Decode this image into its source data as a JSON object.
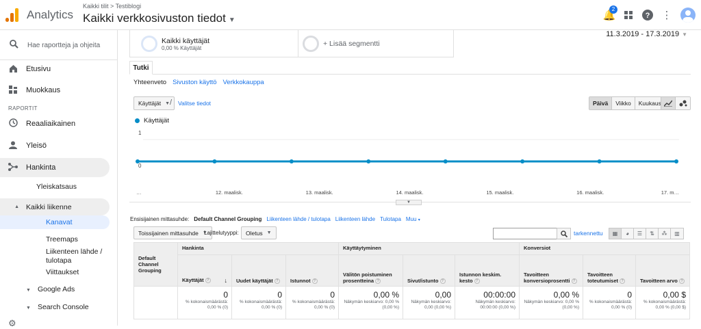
{
  "header": {
    "app_title": "Analytics",
    "breadcrumb": "Kaikki tilit > Testiblogi",
    "view_title": "Kaikki verkkosivuston tiedot",
    "notification_count": "2"
  },
  "sidebar": {
    "search_placeholder": "Hae raportteja ja ohjeita",
    "home": "Etusivu",
    "customize": "Muokkaus",
    "section_reports": "RAPORTIT",
    "realtime": "Reaaliaikainen",
    "audience": "Yleisö",
    "acquisition": "Hankinta",
    "overview": "Yleiskatsaus",
    "all_traffic": "Kaikki liikenne",
    "channels": "Kanavat",
    "treemaps": "Treemaps",
    "source_medium": "Liikenteen lähde / tulotapa",
    "referrals": "Viittaukset",
    "google_ads": "Google Ads",
    "search_console": "Search Console"
  },
  "segments": {
    "seg1_title": "Kaikki käyttäjät",
    "seg1_sub": "0,00 % Käyttäjät",
    "seg2_title": "+ Lisää segmentti"
  },
  "date_range": "11.3.2019 - 17.3.2019",
  "tab_label": "Tutki",
  "subtabs": {
    "summary": "Yhteenveto",
    "site_usage": "Sivuston käyttö",
    "ecommerce": "Verkkokauppa"
  },
  "controls": {
    "metric": "Käyttäjät",
    "select_metric": "Valitse tiedot",
    "day": "Päivä",
    "week": "Viikko",
    "month": "Kuukausi"
  },
  "chart_data": {
    "type": "line",
    "series": [
      {
        "name": "Käyttäjät",
        "values": [
          0,
          0,
          0,
          0,
          0,
          0,
          0,
          0
        ]
      }
    ],
    "x": [
      "…",
      "12. maalisk.",
      "13. maalisk.",
      "14. maalisk.",
      "15. maalisk.",
      "16. maalisk.",
      "17. m…"
    ],
    "ylim": [
      0,
      1
    ],
    "yticks": [
      "1",
      "0"
    ],
    "color": "#058dc7"
  },
  "dimensions": {
    "label": "Ensisijainen mittasuhde:",
    "active": "Default Channel Grouping",
    "links": [
      "Liikenteen lähde / tulotapa",
      "Liikenteen lähde",
      "Tulotapa",
      "Muu"
    ]
  },
  "table_controls": {
    "secondary": "Toissijainen mittasuhde",
    "sort_type_label": "Lajittelutyyppi:",
    "sort_type": "Oletus",
    "advanced": "tarkennettu"
  },
  "table": {
    "dim_header": "Default Channel Grouping",
    "groups": [
      "Hankinta",
      "Käyttäytyminen",
      "Konversiot"
    ],
    "columns": [
      "Käyttäjät",
      "Uudet käyttäjät",
      "Istunnot",
      "Välitön poistuminen prosentteina",
      "Sivut/istunto",
      "Istunnon keskim. kesto",
      "Tavoitteen konversioprosentti",
      "Tavoitteen toteutumiset",
      "Tavoitteen arvo"
    ],
    "totals": [
      {
        "value": "0",
        "sub": "% kokonaismäärästä: 0,00 % (0)"
      },
      {
        "value": "0",
        "sub": "% kokonaismäärästä: 0,00 % (0)"
      },
      {
        "value": "0",
        "sub": "% kokonaismäärästä: 0,00 % (0)"
      },
      {
        "value": "0,00 %",
        "sub": "Näkymän keskiarvo: 0,00 % (0,00 %)"
      },
      {
        "value": "0,00",
        "sub": "Näkymän keskiarvo: 0,00 (0,00 %)"
      },
      {
        "value": "00:00:00",
        "sub": "Näkymän keskiarvo: 00:00:00 (0,00 %)"
      },
      {
        "value": "0,00 %",
        "sub": "Näkymän keskiarvo: 0,00 % (0,00 %)"
      },
      {
        "value": "0",
        "sub": "% kokonaismäärästä: 0,00 % (0)"
      },
      {
        "value": "0,00 $",
        "sub": "% kokonaismäärästä: 0,00 % (0,00 $)"
      }
    ]
  }
}
